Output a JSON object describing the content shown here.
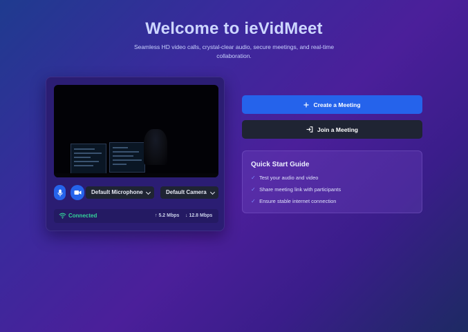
{
  "hero": {
    "title": "Welcome to ieVidMeet",
    "subtitle": "Seamless HD video calls, crystal-clear audio, secure meetings, and real-time collaboration."
  },
  "preview": {
    "microphone_select": "Default Microphone",
    "camera_select": "Default Camera",
    "status": "Connected",
    "upload": "↑ 5.2 Mbps",
    "download": "↓ 12.8 Mbps"
  },
  "actions": {
    "create_label": "Create a Meeting",
    "join_label": "Join a Meeting"
  },
  "guide": {
    "title": "Quick Start Guide",
    "items": [
      "Test your audio and video",
      "Share meeting link with participants",
      "Ensure stable internet connection"
    ]
  },
  "icons": {
    "mic": "microphone-icon",
    "camera": "video-camera-icon",
    "wifi": "wifi-icon",
    "plus": "plus-icon",
    "join": "sign-in-icon",
    "check": "check-icon"
  },
  "colors": {
    "primary": "#2563eb",
    "dark_button": "#1f2433",
    "connected": "#34d399"
  }
}
